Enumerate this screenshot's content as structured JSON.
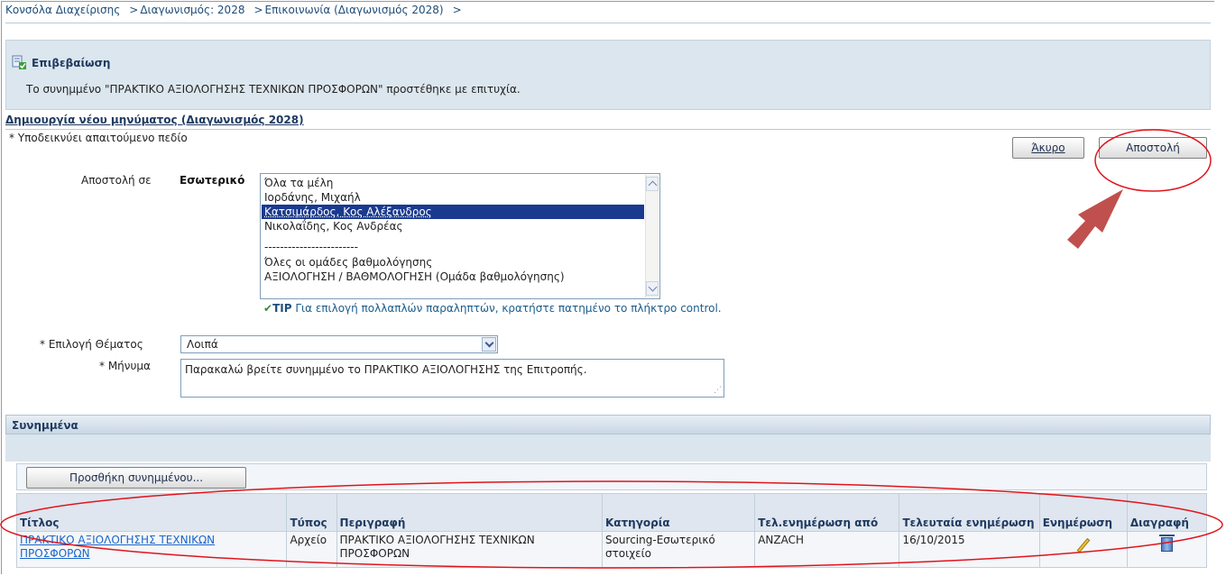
{
  "breadcrumb": {
    "items": [
      "Κονσόλα Διαχείρισης",
      "Διαγωνισμός: 2028",
      "Επικοινωνία (Διαγωνισμός 2028)"
    ],
    "separator": ">"
  },
  "confirmation": {
    "title": "Επιβεβαίωση",
    "message": "Το συνημμένο \"ΠΡΑΚΤΙΚΟ ΑΞΙΟΛΟΓΗΣΗΣ ΤΕΧΝΙΚΩΝ ΠΡΟΣΦΟΡΩΝ\" προστέθηκε με επιτυχία."
  },
  "form": {
    "section_title": "Δημιουργία νέου μηνύματος (Διαγωνισμός 2028)",
    "required_hint": "* Υποδεικνύει απαιτούμενο πεδίο",
    "cancel_label": "Άκυρο",
    "send_label": "Αποστολή",
    "send_to_label": "Αποστολή σε",
    "internal_label": "Εσωτερικό",
    "recipients": [
      "Όλα τα μέλη",
      "Ιορδάνης, Μιχαήλ",
      "Κατσιμάρδος, Κος Αλέξανδρος",
      "Νικολαΐδης, Κος Ανδρέας",
      "------------------------",
      "Όλες οι ομάδες βαθμολόγησης",
      "ΑΞΙΟΛΟΓΗΣΗ / ΒΑΘΜΟΛΟΓΗΣΗ (Ομάδα βαθμολόγησης)"
    ],
    "selected_recipient_index": 2,
    "tip_label": "TIP",
    "tip_text": "Για επιλογή πολλαπλών παραληπτών, κρατήστε πατημένο το πλήκτρο control.",
    "subject_label": "* Επιλογή Θέματος",
    "subject_value": "Λοιπά",
    "message_label": "* Μήνυμα",
    "message_value": "Παρακαλώ βρείτε συνημμένο το ΠΡΑΚΤΙΚΟ ΑΞΙΟΛΟΓΗΣΗΣ της Επιτροπής."
  },
  "attachments": {
    "header": "Συνημμένα",
    "add_button": "Προσθήκη συνημμένου...",
    "columns": [
      "Τίτλος",
      "Τύπος",
      "Περιγραφή",
      "Κατηγορία",
      "Τελ.ενημέρωση από",
      "Τελευταία ενημέρωση",
      "Ενημέρωση",
      "Διαγραφή"
    ],
    "rows": [
      {
        "title": "ΠΡΑΚΤΙΚΟ ΑΞΙΟΛΟΓΗΣΗΣ ΤΕΧΝΙΚΩΝ ΠΡΟΣΦΟΡΩΝ",
        "type": "Αρχείο",
        "description": "ΠΡΑΚΤΙΚΟ ΑΞΙΟΛΟΓΗΣΗΣ ΤΕΧΝΙΚΩΝ ΠΡΟΣΦΟΡΩΝ",
        "category": "Sourcing-Εσωτερικό στοιχείο",
        "updated_by": "ANZACH",
        "last_updated": "16/10/2015",
        "update_icon": "pencil-icon",
        "delete_icon": "trash-icon"
      }
    ]
  },
  "colors": {
    "link": "#1b66c9",
    "header_text": "#1f3a60",
    "confirm_bg": "#dce6ee",
    "selection_bg": "#1a3a8f",
    "annotation_red": "#e0141c",
    "arrow_fill": "#c0504d"
  }
}
